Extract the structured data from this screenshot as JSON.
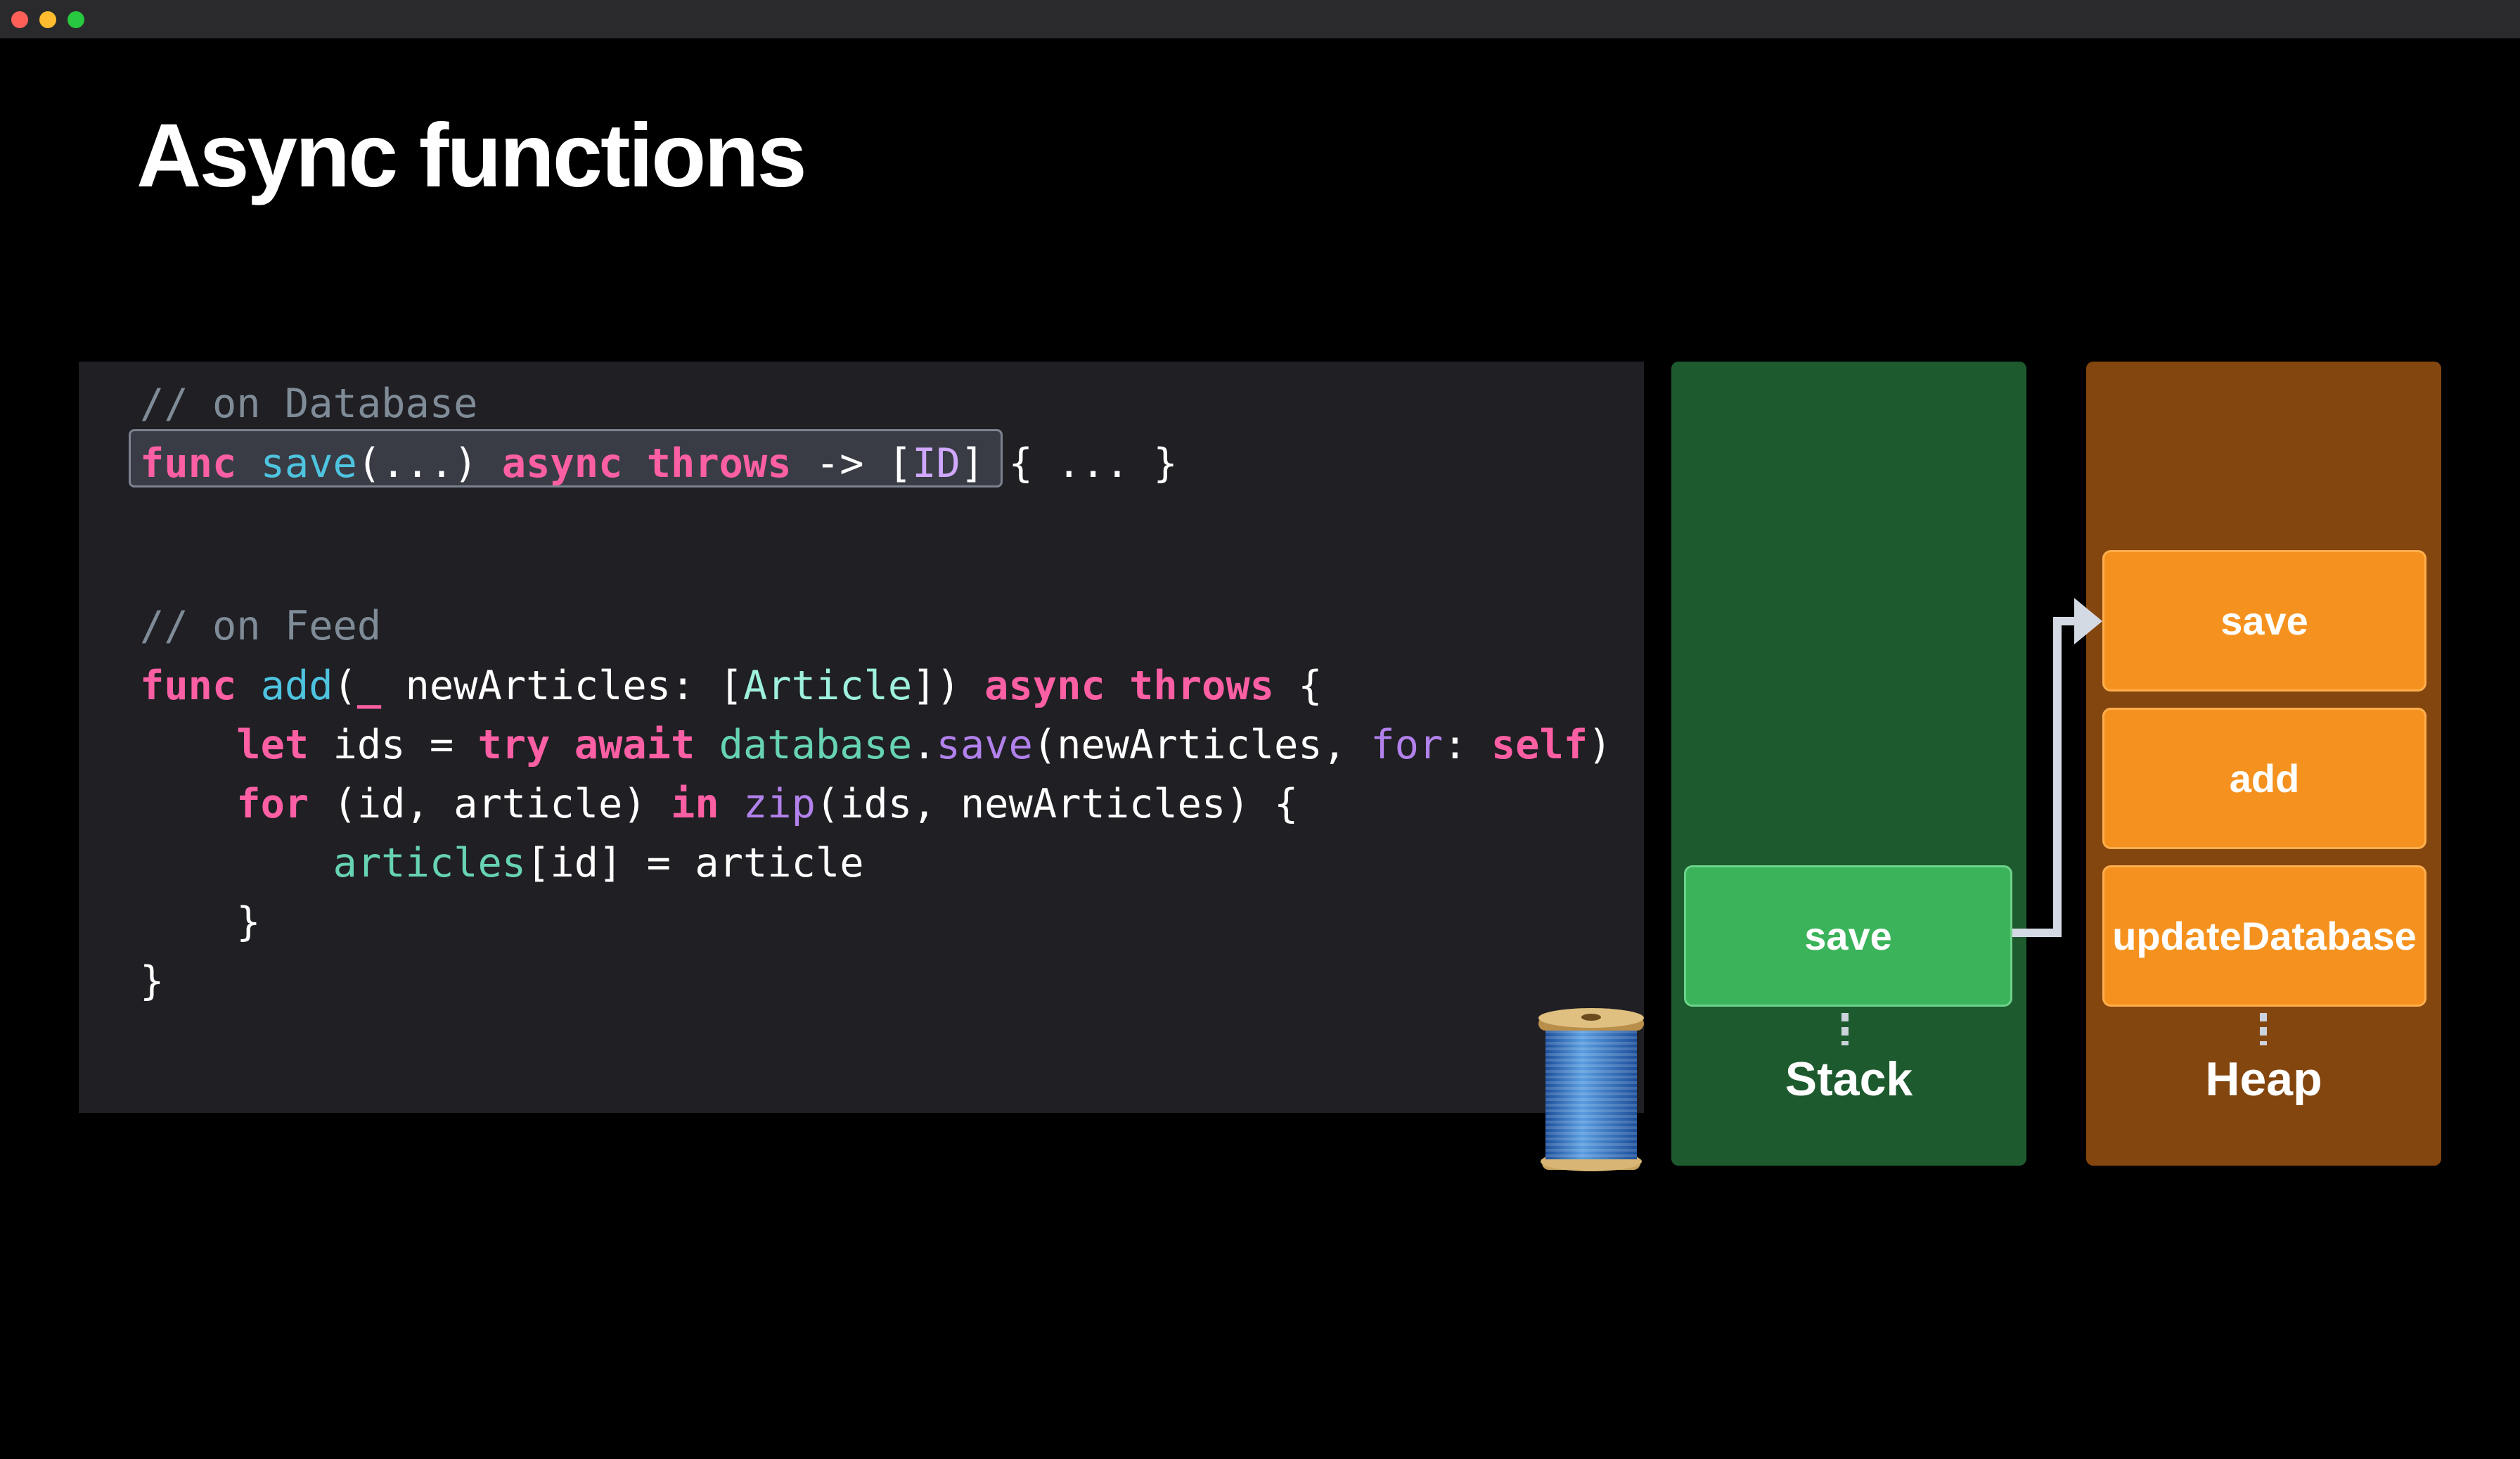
{
  "window": {
    "controls": [
      {
        "name": "close",
        "color": "#ff5f57"
      },
      {
        "name": "minimize",
        "color": "#febc2e"
      },
      {
        "name": "zoom",
        "color": "#28c840"
      }
    ]
  },
  "slide": {
    "title": "Async functions"
  },
  "code": {
    "lines": [
      [
        [
          "// on Database",
          "comment"
        ]
      ],
      [
        [
          "func",
          "kw"
        ],
        [
          " ",
          "plain"
        ],
        [
          "save",
          "fn"
        ],
        [
          "(...) ",
          "plain"
        ],
        [
          "async",
          "kw"
        ],
        [
          " ",
          "plain"
        ],
        [
          "throws",
          "kw"
        ],
        [
          " -> [",
          "plain"
        ],
        [
          "ID",
          "id"
        ],
        [
          "] { ... }",
          "plain"
        ]
      ],
      [
        [
          "// on Feed",
          "comment"
        ]
      ],
      [
        [
          "func",
          "kw"
        ],
        [
          " ",
          "plain"
        ],
        [
          "add",
          "fn"
        ],
        [
          "(",
          "plain"
        ],
        [
          "_",
          "kw"
        ],
        [
          " newArticles: [",
          "plain"
        ],
        [
          "Article",
          "type"
        ],
        [
          "]) ",
          "plain"
        ],
        [
          "async",
          "kw"
        ],
        [
          " ",
          "plain"
        ],
        [
          "throws",
          "kw"
        ],
        [
          " {",
          "plain"
        ]
      ],
      [
        [
          "    ",
          "plain"
        ],
        [
          "let",
          "kw"
        ],
        [
          " ids = ",
          "plain"
        ],
        [
          "try",
          "kw"
        ],
        [
          " ",
          "plain"
        ],
        [
          "await",
          "kw"
        ],
        [
          " ",
          "plain"
        ],
        [
          "database",
          "var"
        ],
        [
          ".",
          "plain"
        ],
        [
          "save",
          "label"
        ],
        [
          "(newArticles, ",
          "plain"
        ],
        [
          "for",
          "label"
        ],
        [
          ": ",
          "plain"
        ],
        [
          "self",
          "kw"
        ],
        [
          ")",
          "plain"
        ]
      ],
      [
        [
          "    ",
          "plain"
        ],
        [
          "for",
          "kw"
        ],
        [
          " (id, article) ",
          "plain"
        ],
        [
          "in",
          "kw"
        ],
        [
          " ",
          "plain"
        ],
        [
          "zip",
          "label"
        ],
        [
          "(ids, newArticles) {",
          "plain"
        ]
      ],
      [
        [
          "        ",
          "plain"
        ],
        [
          "articles",
          "var"
        ],
        [
          "[id] = article",
          "plain"
        ]
      ],
      [
        [
          "    }",
          "plain"
        ]
      ],
      [
        [
          "}",
          "plain"
        ]
      ]
    ]
  },
  "diagram": {
    "stack": {
      "label": "Stack",
      "color": "#1d5a2e",
      "frames": [
        {
          "label": "save",
          "color": "#3bb35a"
        }
      ]
    },
    "heap": {
      "label": "Heap",
      "color": "#84460f",
      "frames": [
        {
          "label": "save",
          "color": "#f5921f"
        },
        {
          "label": "add",
          "color": "#f5921f"
        },
        {
          "label": "updateDatabase",
          "color": "#f5921f"
        }
      ]
    },
    "icons": [
      "spool-of-thread-icon",
      "arrow-right-icon"
    ]
  }
}
